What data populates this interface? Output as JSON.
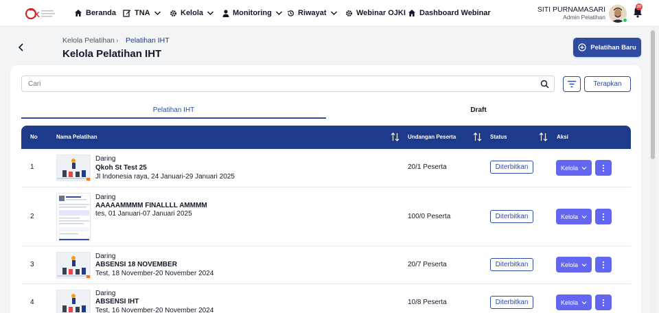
{
  "nav": {
    "items": [
      {
        "label": "Beranda",
        "icon": "home-icon",
        "dropdown": false
      },
      {
        "label": "TNA",
        "icon": "edit-icon",
        "dropdown": true
      },
      {
        "label": "Kelola",
        "icon": "gear-icon",
        "dropdown": true
      },
      {
        "label": "Monitoring",
        "icon": "person-icon",
        "dropdown": true
      },
      {
        "label": "Riwayat",
        "icon": "history-icon",
        "dropdown": true
      },
      {
        "label": "Webinar OJKI",
        "icon": "gear-icon",
        "dropdown": false
      },
      {
        "label": "Dashboard Webinar",
        "icon": "home-icon",
        "dropdown": false
      }
    ],
    "user_name": "SITI PURNAMASARI",
    "user_role": "Admin Pelatihan",
    "notification_count": "20"
  },
  "header": {
    "breadcrumb_1": "Kelola Pelatihan",
    "breadcrumb_sep": "›",
    "breadcrumb_2": "Pelatihan IHT",
    "title": "Kelola Pelatihan IHT",
    "new_button": "Pelatihan Baru"
  },
  "filters": {
    "search_placeholder": "Cari",
    "apply_label": "Terapkan"
  },
  "tabs": [
    {
      "label": "Pelatihan IHT",
      "active": true
    },
    {
      "label": "Draft",
      "active": false
    }
  ],
  "table": {
    "columns": {
      "no": "No",
      "name": "Nama Pelatihan",
      "invite": "Undangan Peserta",
      "status": "Status",
      "action": "Aksi"
    },
    "rows": [
      {
        "no": "1",
        "mode": "Daring",
        "title": "Qkoh St Test 25",
        "meta": "Jl Indonesia raya, 24 Januari-29 Januari 2025",
        "invite": "20/1 Peserta",
        "status": "Diterbitkan",
        "action": "Kelola"
      },
      {
        "no": "2",
        "mode": "Daring",
        "title": "AAAAAMMMM FINALLLL AMMMM",
        "meta": "tes, 01 Januari-07 Januari 2025",
        "invite": "100/0 Peserta",
        "status": "Diterbitkan",
        "action": "Kelola"
      },
      {
        "no": "3",
        "mode": "Daring",
        "title": "ABSENSI 18 NOVEMBER",
        "meta": "Test, 18 November-20 November 2024",
        "invite": "20/7 Peserta",
        "status": "Diterbitkan",
        "action": "Kelola"
      },
      {
        "no": "4",
        "mode": "Daring",
        "title": "ABSENSI IHT",
        "meta": "Test, 16 November-20 November 2024",
        "invite": "10/8 Peserta",
        "status": "Diterbitkan",
        "action": "Kelola"
      }
    ]
  },
  "colors": {
    "primary": "#2f4ba0",
    "table_header": "#1e3a8a",
    "action_button": "#6366f1"
  }
}
